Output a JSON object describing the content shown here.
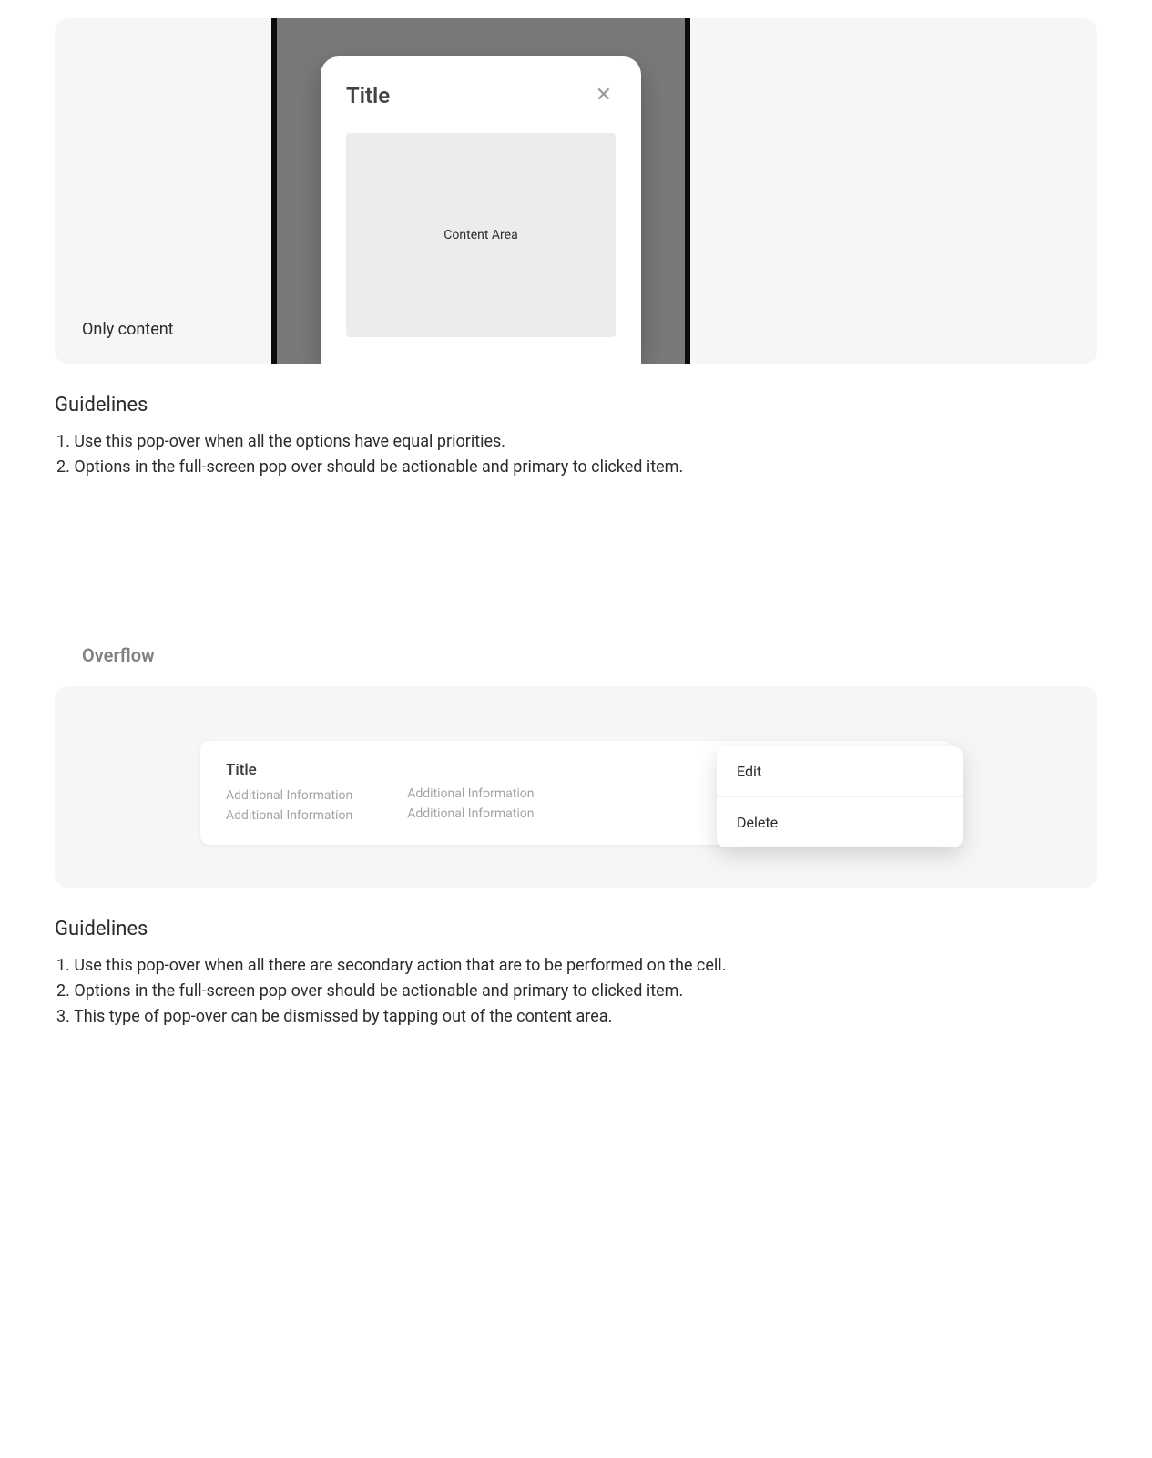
{
  "section1": {
    "caption": "Only content",
    "popover": {
      "title": "Title",
      "content_placeholder": "Content Area"
    }
  },
  "guidelines1": {
    "heading": "Guidelines",
    "items": [
      "1. Use this pop-over when all the options have equal priorities.",
      "2. Options in the full-screen pop over should be actionable and primary to clicked item."
    ]
  },
  "overflow": {
    "label": "Overflow",
    "cell": {
      "title": "Title",
      "col1": [
        "Additional Information",
        "Additional Information"
      ],
      "col2": [
        "Additional Information",
        "Additional Information"
      ]
    },
    "menu": {
      "items": [
        "Edit",
        "Delete"
      ]
    }
  },
  "guidelines2": {
    "heading": "Guidelines",
    "items": [
      "1. Use this pop-over when all there are secondary action that are to be performed on the cell.",
      "2. Options in the full-screen pop over should be actionable and primary to clicked item.",
      "3. This type of pop-over can be dismissed by tapping out of the content area."
    ]
  }
}
